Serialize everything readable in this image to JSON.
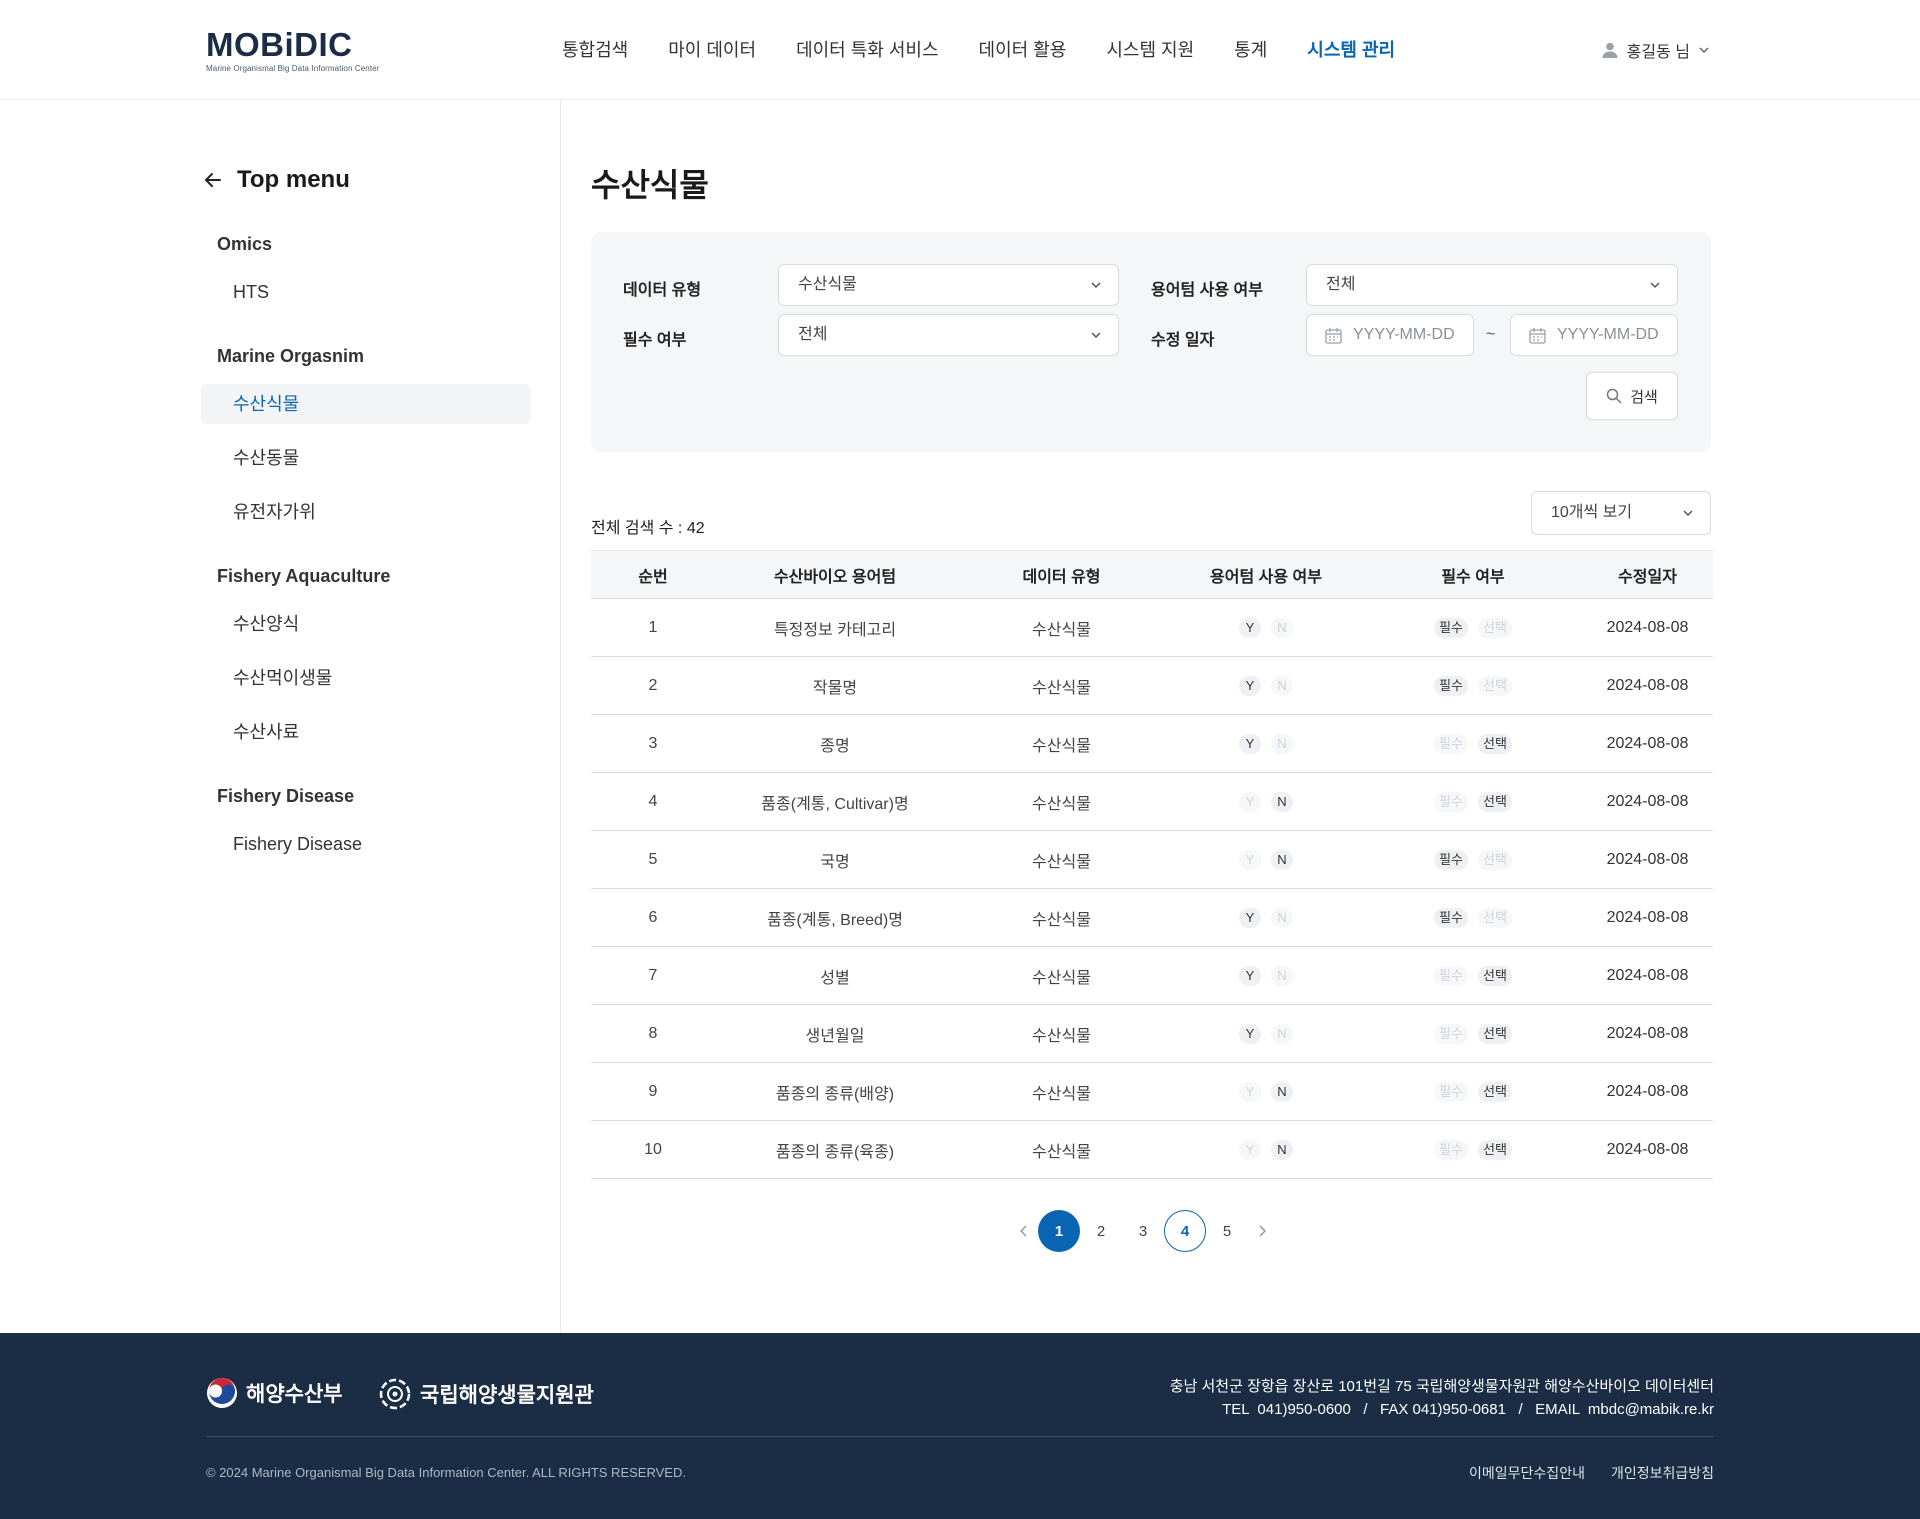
{
  "header": {
    "logo_text": "MOBiDIC",
    "logo_sub": "Marine Organismal Big Data Information Center",
    "nav": [
      {
        "label": "통합검색",
        "active": false
      },
      {
        "label": "마이 데이터",
        "active": false
      },
      {
        "label": "데이터 특화 서비스",
        "active": false
      },
      {
        "label": "데이터 활용",
        "active": false
      },
      {
        "label": "시스템 지원",
        "active": false
      },
      {
        "label": "통계",
        "active": false
      },
      {
        "label": "시스템 관리",
        "active": true
      }
    ],
    "user_name": "홍길동 님"
  },
  "sidebar": {
    "back_title": "Top menu",
    "groups": [
      {
        "label": "Omics",
        "items": [
          {
            "label": "HTS",
            "active": false
          }
        ]
      },
      {
        "label": "Marine Orgasnim",
        "items": [
          {
            "label": "수산식물",
            "active": true
          },
          {
            "label": "수산동물",
            "active": false
          },
          {
            "label": "유전자가위",
            "active": false
          }
        ]
      },
      {
        "label": "Fishery Aquaculture",
        "items": [
          {
            "label": "수산양식",
            "active": false
          },
          {
            "label": "수산먹이생물",
            "active": false
          },
          {
            "label": "수산사료",
            "active": false
          }
        ]
      },
      {
        "label": "Fishery Disease",
        "items": [
          {
            "label": "Fishery Disease",
            "active": false
          }
        ]
      }
    ]
  },
  "main": {
    "title": "수산식물",
    "filters": {
      "data_type_label": "데이터 유형",
      "data_type_value": "수산식물",
      "term_use_label": "용어텀 사용 여부",
      "term_use_value": "전체",
      "required_label": "필수 여부",
      "required_value": "전체",
      "modified_label": "수정 일자",
      "date_from_placeholder": "YYYY-MM-DD",
      "date_to_placeholder": "YYYY-MM-DD",
      "tilde": "~",
      "search_label": "검색"
    },
    "total_text": "전체 검색 수 : 42",
    "per_page": "10개씩 보기",
    "table": {
      "headers": [
        "순번",
        "수산바이오 용어텀",
        "데이터 유형",
        "용어텀 사용 여부",
        "필수 여부",
        "수정일자"
      ],
      "chip_labels": {
        "y": "Y",
        "n": "N",
        "required": "필수",
        "optional": "선택"
      },
      "rows": [
        {
          "no": "1",
          "term": "특정정보 카테고리",
          "type": "수산식물",
          "use": "Y",
          "req": "필수",
          "date": "2024-08-08"
        },
        {
          "no": "2",
          "term": "작물명",
          "type": "수산식물",
          "use": "Y",
          "req": "필수",
          "date": "2024-08-08"
        },
        {
          "no": "3",
          "term": "종명",
          "type": "수산식물",
          "use": "Y",
          "req": "선택",
          "date": "2024-08-08"
        },
        {
          "no": "4",
          "term": "품종(계통, Cultivar)명",
          "type": "수산식물",
          "use": "N",
          "req": "선택",
          "date": "2024-08-08"
        },
        {
          "no": "5",
          "term": "국명",
          "type": "수산식물",
          "use": "N",
          "req": "필수",
          "date": "2024-08-08"
        },
        {
          "no": "6",
          "term": "품종(계통, Breed)명",
          "type": "수산식물",
          "use": "Y",
          "req": "필수",
          "date": "2024-08-08"
        },
        {
          "no": "7",
          "term": "성별",
          "type": "수산식물",
          "use": "Y",
          "req": "선택",
          "date": "2024-08-08"
        },
        {
          "no": "8",
          "term": "생년월일",
          "type": "수산식물",
          "use": "Y",
          "req": "선택",
          "date": "2024-08-08"
        },
        {
          "no": "9",
          "term": "품종의 종류(배양)",
          "type": "수산식물",
          "use": "N",
          "req": "선택",
          "date": "2024-08-08"
        },
        {
          "no": "10",
          "term": "품종의 종류(육종)",
          "type": "수산식물",
          "use": "N",
          "req": "선택",
          "date": "2024-08-08"
        }
      ]
    },
    "pagination": {
      "pages": [
        "1",
        "2",
        "3",
        "4",
        "5"
      ],
      "current": "1",
      "outlined": "4"
    }
  },
  "footer": {
    "org1": "해양수산부",
    "org2": "국립해양생물지원관",
    "address": "충남 서천군 장항읍 장산로 101번길 75 국립해양생물자원관 해양수산바이오 데이터센터",
    "contact": "TEL  041)950-0600   /   FAX 041)950-0681   /   EMAIL  mbdc@mabik.re.kr",
    "copyright": "© 2024 Marine Organismal Big Data Information Center. ALL RIGHTS RESERVED.",
    "links": [
      "이메일무단수집안내",
      "개인정보취급방침"
    ]
  },
  "colors": {
    "accent": "#0a64b4",
    "footer_bg": "#1a2d44"
  }
}
